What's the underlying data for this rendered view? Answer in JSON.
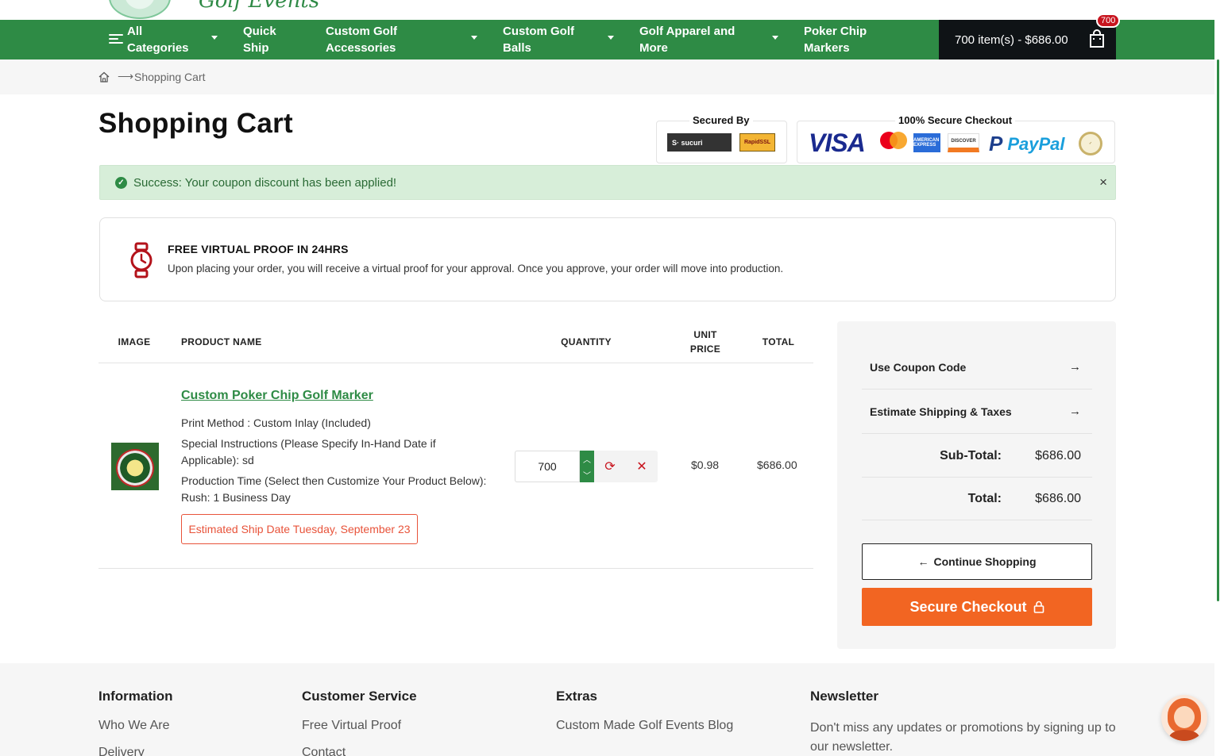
{
  "nav": {
    "items": [
      {
        "label": "All\nCategories"
      },
      {
        "label": "Quick\nShip"
      },
      {
        "label": "Custom Golf\nAccessories"
      },
      {
        "label": "Custom Golf\nBalls"
      },
      {
        "label": "Golf Apparel and\nMore"
      },
      {
        "label": "Poker Chip\nMarkers"
      }
    ],
    "cart_summary": "700 item(s) - $686.00",
    "cart_badge": "700"
  },
  "logo": {
    "text": "Golf Events"
  },
  "breadcrumb": {
    "current": "Shopping Cart"
  },
  "page": {
    "title": "Shopping Cart"
  },
  "security": {
    "secured_by": "Secured By",
    "secure_checkout": "100% Secure Checkout",
    "sucuri": "S· sucuri",
    "rapidssl": "RapidSSL",
    "visa": "VISA",
    "amex": "AMERICAN EXPRESS",
    "discover": "DISCOVER",
    "paypal": "PayPal"
  },
  "alert": {
    "text": "Success: Your coupon discount has been applied!",
    "close": "×"
  },
  "proof": {
    "title": "FREE VIRTUAL PROOF IN 24HRS",
    "text": "Upon placing your order, you will receive a virtual proof for your approval. Once you approve, your order will move into production."
  },
  "table": {
    "headers": {
      "image": "IMAGE",
      "product": "PRODUCT NAME",
      "quantity": "QUANTITY",
      "unit_price": "UNIT PRICE",
      "total": "TOTAL"
    },
    "row": {
      "name": "Custom Poker Chip Golf Marker",
      "options": [
        "Print Method : Custom Inlay (Included)",
        "Special Instructions (Please Specify In-Hand Date if Applicable): sd",
        "Production Time (Select then Customize Your Product Below): Rush: 1 Business Day"
      ],
      "ship_date": "Estimated Ship Date Tuesday, September 23",
      "quantity": "700",
      "unit_price": "$0.98",
      "total": "$686.00"
    }
  },
  "summary": {
    "coupon": "Use Coupon Code",
    "shipping": "Estimate Shipping & Taxes",
    "subtotal_label": "Sub-Total:",
    "subtotal_value": "$686.00",
    "total_label": "Total:",
    "total_value": "$686.00",
    "continue": "Continue Shopping",
    "checkout": "Secure Checkout"
  },
  "footer": {
    "cols": [
      {
        "title": "Information",
        "links": [
          "Who We Are",
          "Delivery"
        ]
      },
      {
        "title": "Customer Service",
        "links": [
          "Free Virtual Proof",
          "Contact"
        ]
      },
      {
        "title": "Extras",
        "links": [
          "Custom Made Golf Events Blog"
        ]
      },
      {
        "title": "Newsletter",
        "text": "Don't miss any updates or promotions by signing up to our newsletter."
      }
    ]
  },
  "colors": {
    "brand_green": "#2e8b45",
    "checkout_orange": "#f26522",
    "alert_red": "#c8141e"
  }
}
